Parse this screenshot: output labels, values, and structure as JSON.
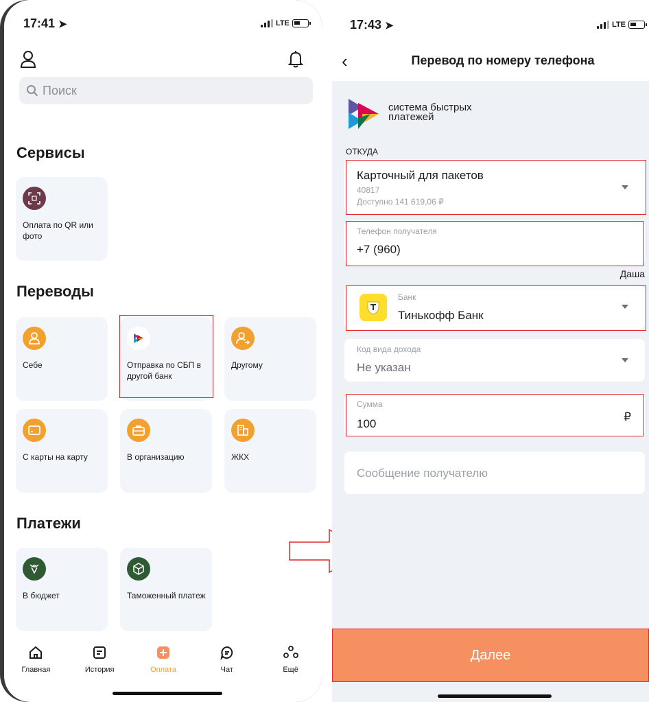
{
  "left": {
    "status_time": "17:41",
    "status_network": "LTE",
    "search_placeholder": "Поиск",
    "sections": {
      "services": "Сервисы",
      "transfers": "Переводы",
      "payments": "Платежи"
    },
    "services": [
      {
        "label": "Оплата по QR или фото",
        "icon": "qr-scan-icon"
      }
    ],
    "transfers": [
      {
        "label": "Себе",
        "icon": "user-icon"
      },
      {
        "label": "Отправка по СБП в другой банк",
        "icon": "sbp-icon"
      },
      {
        "label": "Другому",
        "icon": "user-send-icon"
      },
      {
        "label": "С карты на карту",
        "icon": "card-icon"
      },
      {
        "label": "В организацию",
        "icon": "briefcase-icon"
      },
      {
        "label": "ЖКХ",
        "icon": "building-icon"
      }
    ],
    "payments": [
      {
        "label": "В бюджет",
        "icon": "emblem-icon"
      },
      {
        "label": "Таможенный платеж",
        "icon": "box-icon"
      }
    ],
    "nav": [
      {
        "label": "Главная",
        "icon": "home-icon"
      },
      {
        "label": "История",
        "icon": "history-icon"
      },
      {
        "label": "Оплата",
        "icon": "plus-icon",
        "active": true
      },
      {
        "label": "Чат",
        "icon": "chat-icon"
      },
      {
        "label": "Ещё",
        "icon": "more-icon"
      }
    ]
  },
  "right": {
    "status_time": "17:43",
    "status_network": "LTE",
    "title": "Перевод по номеру телефона",
    "sbp_text_line1": "система быстрых",
    "sbp_text_line2": "платежей",
    "from_label": "ОТКУДА",
    "account_name": "Карточный для пакетов",
    "account_number": "40817",
    "account_available": "Доступно 141 619,06 ₽",
    "phone_label": "Телефон получателя",
    "phone_value": "+7 (960)",
    "recipient_name": "Даша",
    "bank_label": "Банк",
    "bank_value": "Тинькофф Банк",
    "income_code_label": "Код вида дохода",
    "income_code_value": "Не указан",
    "amount_label": "Сумма",
    "amount_value": "100",
    "currency": "₽",
    "message_placeholder": "Сообщение получателю",
    "next_button": "Далее"
  },
  "colors": {
    "accent_orange": "#f2a12e",
    "button_orange": "#f79060",
    "highlight_red": "#e0272b"
  }
}
